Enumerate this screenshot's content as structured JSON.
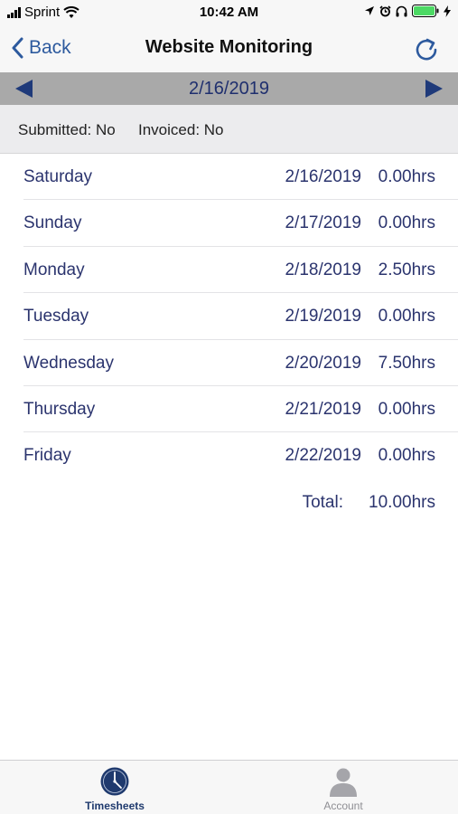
{
  "status_bar": {
    "carrier": "Sprint",
    "time": "10:42 AM",
    "icons": [
      "signal-bars-icon",
      "wifi-icon",
      "location-arrow-icon",
      "alarm-icon",
      "headphones-icon",
      "battery-icon",
      "charging-bolt-icon"
    ],
    "battery_color": "#4cd964"
  },
  "nav": {
    "back_label": "Back",
    "title": "Website Monitoring",
    "refresh_icon": "refresh-icon",
    "accent_color": "#2d5a9e"
  },
  "date_bar": {
    "date": "2/16/2019",
    "prev_icon": "triangle-left-icon",
    "next_icon": "triangle-right-icon"
  },
  "info": {
    "submitted": "Submitted: No",
    "invoiced": "Invoiced: No"
  },
  "days": [
    {
      "day": "Saturday",
      "date": "2/16/2019",
      "hours": "0.00hrs"
    },
    {
      "day": "Sunday",
      "date": "2/17/2019",
      "hours": "0.00hrs"
    },
    {
      "day": "Monday",
      "date": "2/18/2019",
      "hours": "2.50hrs"
    },
    {
      "day": "Tuesday",
      "date": "2/19/2019",
      "hours": "0.00hrs"
    },
    {
      "day": "Wednesday",
      "date": "2/20/2019",
      "hours": "7.50hrs"
    },
    {
      "day": "Thursday",
      "date": "2/21/2019",
      "hours": "0.00hrs"
    },
    {
      "day": "Friday",
      "date": "2/22/2019",
      "hours": "0.00hrs"
    }
  ],
  "total": {
    "label": "Total:",
    "value": "10.00hrs"
  },
  "tabs": [
    {
      "label": "Timesheets",
      "icon": "clock-icon",
      "selected": true
    },
    {
      "label": "Account",
      "icon": "person-icon",
      "selected": false
    }
  ]
}
